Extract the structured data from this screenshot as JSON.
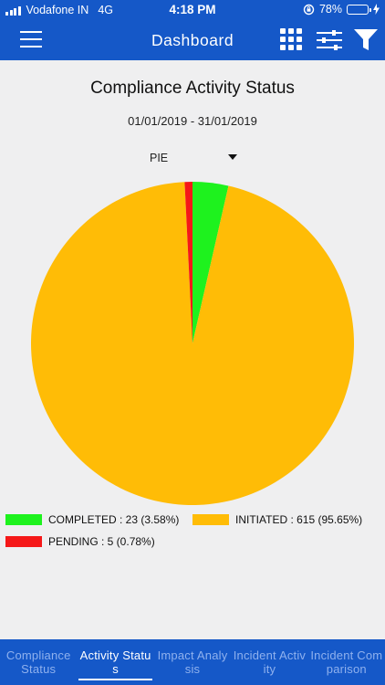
{
  "status_bar": {
    "carrier": "Vodafone IN",
    "network": "4G",
    "time": "4:18 PM",
    "battery_percent": "78%",
    "battery_level": 0.78
  },
  "app_bar": {
    "title": "Dashboard",
    "menu_icon": "hamburger-menu-icon",
    "grid_icon": "grid-icon",
    "settings_icon": "sliders-icon",
    "filter_icon": "filter-icon"
  },
  "report": {
    "date_range": "01/01/2019 - 31/01/2019",
    "chart_type_selected": "PIE"
  },
  "chart_data": {
    "type": "pie",
    "title": "Compliance Activity Status",
    "slices": [
      {
        "label": "COMPLETED : 23 (3.58%)",
        "value": 23,
        "percent": 3.58,
        "color": "#1ef21e"
      },
      {
        "label": "INITIATED : 615 (95.65%)",
        "value": 615,
        "percent": 95.65,
        "color": "#ffbc06"
      },
      {
        "label": "PENDING : 5 (0.78%)",
        "value": 5,
        "percent": 0.78,
        "color": "#f51818"
      }
    ],
    "legend_placement": "bottom-left"
  },
  "bottom_tabs": [
    {
      "label": "Compliance Status",
      "active": false
    },
    {
      "label": "Activity Status",
      "active": true
    },
    {
      "label": "Impact Analysis",
      "active": false
    },
    {
      "label": "Incident Activity",
      "active": false
    },
    {
      "label": "Incident Comparison",
      "active": false
    }
  ]
}
